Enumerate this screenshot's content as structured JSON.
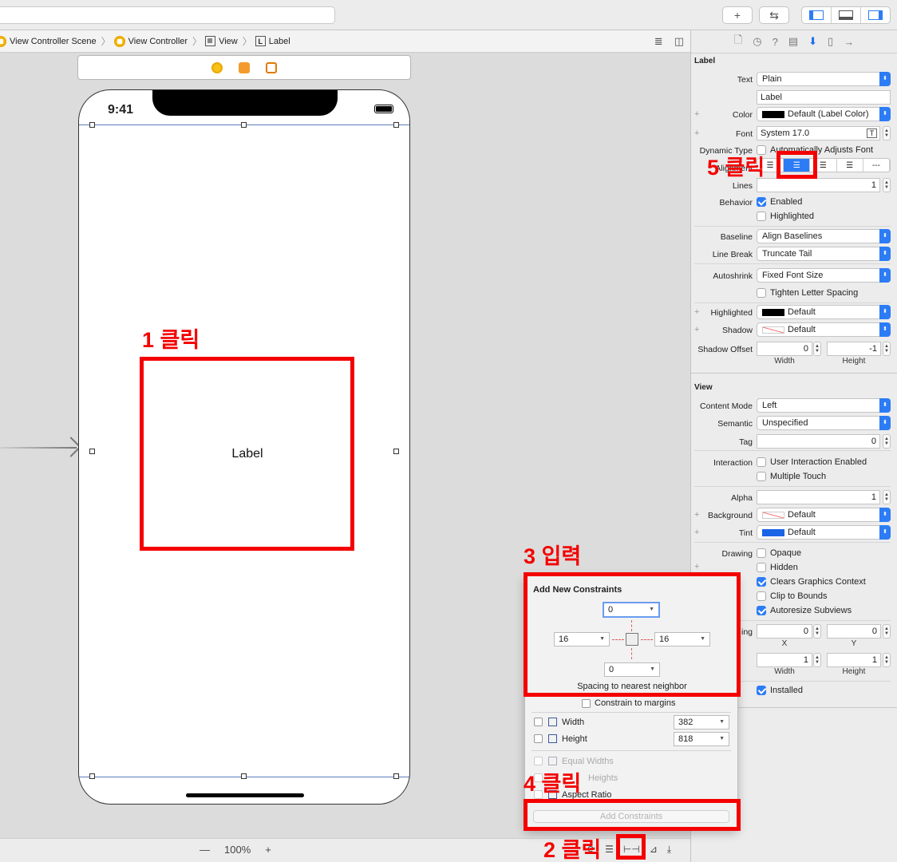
{
  "toolbar": {
    "add_glyph": "+",
    "back_forward_glyph": "⇆"
  },
  "breadcrumbs": [
    "View Controller Scene",
    "View Controller",
    "View",
    "Label"
  ],
  "device": {
    "time": "9:41"
  },
  "canvas": {
    "label_text": "Label",
    "zoom": "100%",
    "zoom_out": "—",
    "zoom_in": "+"
  },
  "inspector": {
    "label_section": "Label",
    "text_label": "Text",
    "text_value": "Plain",
    "text_field": "Label",
    "color_label": "Color",
    "color_value": "Default (Label Color)",
    "font_label": "Font",
    "font_value": "System 17.0",
    "dynamic_type_label": "Dynamic Type",
    "dynamic_type_value": "Automatically Adjusts Font",
    "alignment_label": "Alignment",
    "lines_label": "Lines",
    "lines_value": "1",
    "behavior_label": "Behavior",
    "enabled_label": "Enabled",
    "highlighted_check_label": "Highlighted",
    "baseline_label": "Baseline",
    "baseline_value": "Align Baselines",
    "line_break_label": "Line Break",
    "line_break_value": "Truncate Tail",
    "autoshrink_label": "Autoshrink",
    "autoshrink_value": "Fixed Font Size",
    "tighten_label": "Tighten Letter Spacing",
    "highlighted_label": "Highlighted",
    "highlighted_value": "Default",
    "shadow_label": "Shadow",
    "shadow_value": "Default",
    "shadow_offset_label": "Shadow Offset",
    "shadow_width_value": "0",
    "shadow_height_value": "-1",
    "width_sub": "Width",
    "height_sub": "Height",
    "view_section": "View",
    "content_mode_label": "Content Mode",
    "content_mode_value": "Left",
    "semantic_label": "Semantic",
    "semantic_value": "Unspecified",
    "tag_label": "Tag",
    "tag_value": "0",
    "interaction_label": "Interaction",
    "user_interaction_label": "User Interaction Enabled",
    "multiple_touch_label": "Multiple Touch",
    "alpha_label": "Alpha",
    "alpha_value": "1",
    "background_label": "Background",
    "background_value": "Default",
    "tint_label": "Tint",
    "tint_value": "Default",
    "drawing_label": "Drawing",
    "opaque_label": "Opaque",
    "hidden_label": "Hidden",
    "clears_label": "Clears Graphics Context",
    "clip_label": "Clip to Bounds",
    "autoresize_label": "Autoresize Subviews",
    "stretching_partial": "ing",
    "stretch_x_value": "0",
    "stretch_y_value": "0",
    "x_sub": "X",
    "y_sub": "Y",
    "stretch_w_value": "1",
    "stretch_h_value": "1",
    "installed_label": "Installed",
    "accent_color": "#2c7cf6"
  },
  "constraints": {
    "title": "Add New Constraints",
    "top_value": "0",
    "left_value": "16",
    "right_value": "16",
    "bottom_value": "0",
    "spacing_label": "Spacing to nearest neighbor",
    "margins_label": "Constrain to margins",
    "width_label": "Width",
    "width_value": "382",
    "height_label": "Height",
    "height_value": "818",
    "equal_widths_label": "Equal Widths",
    "equal_heights_partial": "Heights",
    "aspect_ratio_label": "Aspect Ratio",
    "add_button": "Add Constraints"
  },
  "annotations": {
    "step1": "1 클릭",
    "step2": "2 클릭",
    "step3": "3 입력",
    "step4": "4 클릭",
    "step5": "5 클릭",
    "color": "#f40000"
  }
}
